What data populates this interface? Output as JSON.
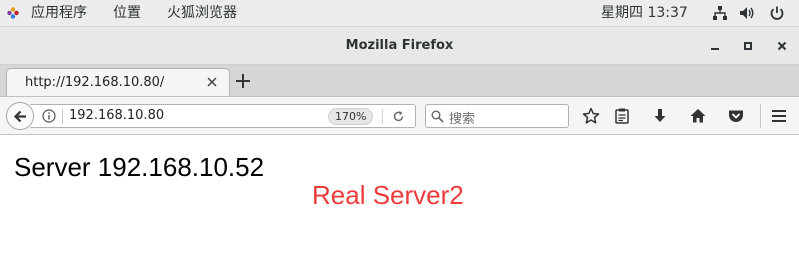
{
  "topbar": {
    "applications": "应用程序",
    "places": "位置",
    "active_app": "火狐浏览器",
    "clock": "星期四 13:37",
    "icons": [
      "network-icon",
      "volume-icon",
      "power-icon"
    ]
  },
  "window": {
    "title": "Mozilla Firefox",
    "controls": [
      "minimize-icon",
      "maximize-icon",
      "close-icon"
    ]
  },
  "tabs": [
    {
      "label": "http://192.168.10.80/",
      "active": true
    }
  ],
  "navbar": {
    "url": "192.168.10.80",
    "zoom": "170%",
    "search_placeholder": "搜索",
    "buttons": [
      "bookmark-star-icon",
      "reading-list-icon",
      "download-icon",
      "home-icon",
      "pocket-icon",
      "menu-icon"
    ]
  },
  "page": {
    "server_line": "Server 192.168.10.52",
    "subtitle": "Real Server2",
    "subtitle_color": "#ec3b3b"
  }
}
